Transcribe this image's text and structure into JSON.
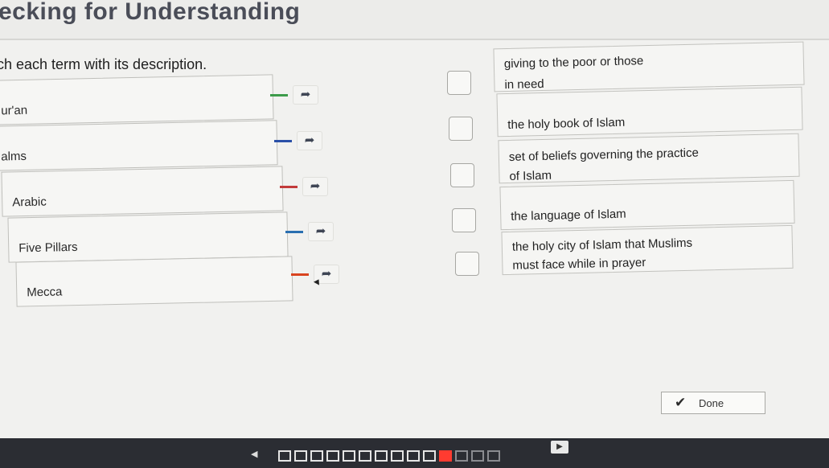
{
  "header": {
    "title": "ecking for Understanding"
  },
  "instructions": "ch each term with its description.",
  "terms": [
    {
      "label": "ur'an",
      "connector_color": "#3c9b4a"
    },
    {
      "label": "alms",
      "connector_color": "#2b50a8"
    },
    {
      "label": "Arabic",
      "connector_color": "#c23a3a"
    },
    {
      "label": "Five Pillars",
      "connector_color": "#2a6fb0"
    },
    {
      "label": "Mecca",
      "connector_color": "#d9441f"
    }
  ],
  "arrow_icon": "arrow-icon",
  "descriptions": [
    {
      "lines": [
        "giving to the poor or those",
        "in need"
      ]
    },
    {
      "lines": [
        "the holy book of Islam"
      ]
    },
    {
      "lines": [
        "set of beliefs governing the practice",
        "of Islam"
      ]
    },
    {
      "lines": [
        "the language of Islam"
      ]
    },
    {
      "lines": [
        "the holy city of Islam that Muslims",
        "must face while in prayer"
      ]
    }
  ],
  "done_button": {
    "label": "Done",
    "icon": "checkmark-icon"
  },
  "navigation": {
    "prev_icon": "◀",
    "next_icon": "▶",
    "pages_total": 14,
    "current_page": 11
  }
}
